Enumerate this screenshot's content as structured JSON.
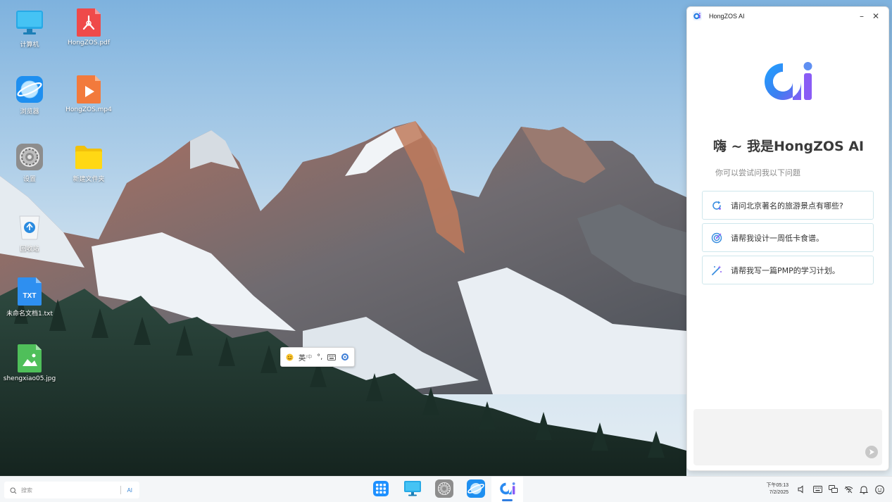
{
  "desktop": {
    "icons": [
      {
        "label": "计算机",
        "icon": "computer-icon"
      },
      {
        "label": "HongZOS.pdf",
        "icon": "pdf-file-icon"
      },
      {
        "label": "浏览器",
        "icon": "browser-icon"
      },
      {
        "label": "HongZOS.mp4",
        "icon": "video-file-icon"
      },
      {
        "label": "设置",
        "icon": "settings-icon"
      },
      {
        "label": "新建文件夹",
        "icon": "folder-icon"
      },
      {
        "label": "回收站",
        "icon": "recycle-bin-icon"
      },
      {
        "label": "未命名文档1.txt",
        "icon": "txt-file-icon",
        "badge": "TXT"
      },
      {
        "label": "shengxiao05.jpg",
        "icon": "image-file-icon"
      }
    ]
  },
  "ime": {
    "mode": "英",
    "mode_sub": "/中"
  },
  "ai_window": {
    "title": "HongZOS AI",
    "greeting": "嗨 ~ 我是HongZOS AI",
    "subtitle": "你可以尝试问我以下问题",
    "suggestions": [
      {
        "text": "请问北京著名的旅游景点有哪些?",
        "icon": "refresh-search-icon"
      },
      {
        "text": "请帮我设计一周低卡食谱。",
        "icon": "target-icon"
      },
      {
        "text": "请帮我写一篇PMP的学习计划。",
        "icon": "magic-wand-icon"
      }
    ],
    "input_placeholder": "",
    "accent": "#1f7ae0",
    "accent2": "#8a5cf5"
  },
  "taskbar": {
    "search_placeholder": "搜索",
    "ai_label": "AI",
    "apps": [
      {
        "name": "start-menu",
        "icon": "grid-icon",
        "active": false
      },
      {
        "name": "computer",
        "icon": "computer-icon",
        "active": false
      },
      {
        "name": "settings",
        "icon": "settings-icon",
        "active": false
      },
      {
        "name": "browser",
        "icon": "browser-icon",
        "active": false
      },
      {
        "name": "hongzos-ai",
        "icon": "ai-logo-icon",
        "active": true
      }
    ],
    "time": "下午05:13",
    "date": "7/2/2025",
    "tray": [
      "volume-icon",
      "keyboard-icon",
      "network-icon",
      "wifi-icon",
      "notification-icon",
      "user-icon"
    ]
  }
}
